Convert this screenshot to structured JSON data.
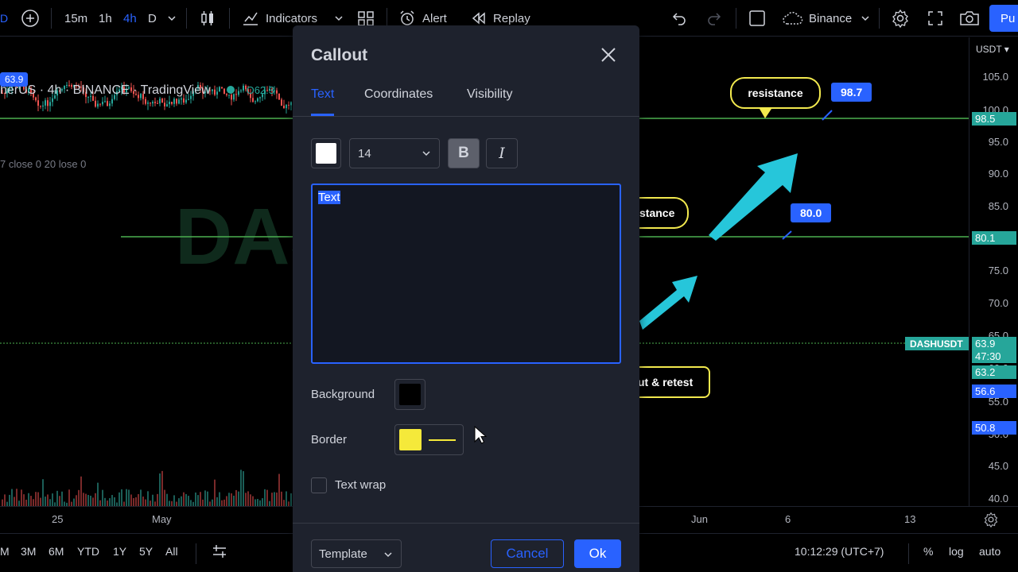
{
  "toolbar": {
    "intervals": [
      "15m",
      "1h",
      "4h",
      "D"
    ],
    "active_interval": "4h",
    "indicators_label": "Indicators",
    "alert_label": "Alert",
    "replay_label": "Replay",
    "exchange_label": "Binance",
    "publish_label": "Pu"
  },
  "chart": {
    "legend_symbol": "herUS · 4h · BINANCE · TradingView",
    "legend_open": "O62.3",
    "legend_row2": "7 close 0 20 lose 0",
    "watermark": "DASH",
    "left_price_badge": "63.9",
    "currency": "USDT",
    "price_ticks": [
      "105.0",
      "100.0",
      "95.0",
      "90.0",
      "85.0",
      "80.0",
      "75.0",
      "70.0",
      "65.0",
      "60.0",
      "55.0",
      "50.0",
      "45.0",
      "40.0"
    ],
    "price_labels": [
      {
        "text": "98.5",
        "color": "#26a69a"
      },
      {
        "text": "80.1",
        "color": "#26a69a"
      },
      {
        "text": "63.9",
        "color": "#26a69a"
      },
      {
        "text": "47:30",
        "color": "#26a69a"
      },
      {
        "text": "63.2",
        "color": "#26a69a"
      },
      {
        "text": "56.6",
        "color": "#2962ff"
      },
      {
        "text": "50.8",
        "color": "#2962ff"
      }
    ],
    "symbol_tag": "DASHUSDT",
    "annotations": {
      "resistance_top": "resistance",
      "resistance_mid": "stance",
      "retest": "ut & retest",
      "badge_top": "98.7",
      "badge_mid": "80.0"
    },
    "time_ticks": [
      "25",
      "May",
      "Jun",
      "6",
      "13"
    ]
  },
  "bottombar": {
    "ranges": [
      "M",
      "3M",
      "6M",
      "YTD",
      "1Y",
      "5Y",
      "All"
    ],
    "clock": "10:12:29 (UTC+7)",
    "percent": "%",
    "log": "log",
    "auto": "auto"
  },
  "dialog": {
    "title": "Callout",
    "tabs": [
      "Text",
      "Coordinates",
      "Visibility"
    ],
    "active_tab": "Text",
    "text_color": "#ffffff",
    "font_size": "14",
    "bold_label": "B",
    "italic_label": "I",
    "text_value": "Text",
    "background_label": "Background",
    "background_color": "#000000",
    "border_label": "Border",
    "border_color": "#f5e93a",
    "text_wrap_label": "Text wrap",
    "text_wrap_checked": false,
    "template_label": "Template",
    "cancel_label": "Cancel",
    "ok_label": "Ok"
  }
}
